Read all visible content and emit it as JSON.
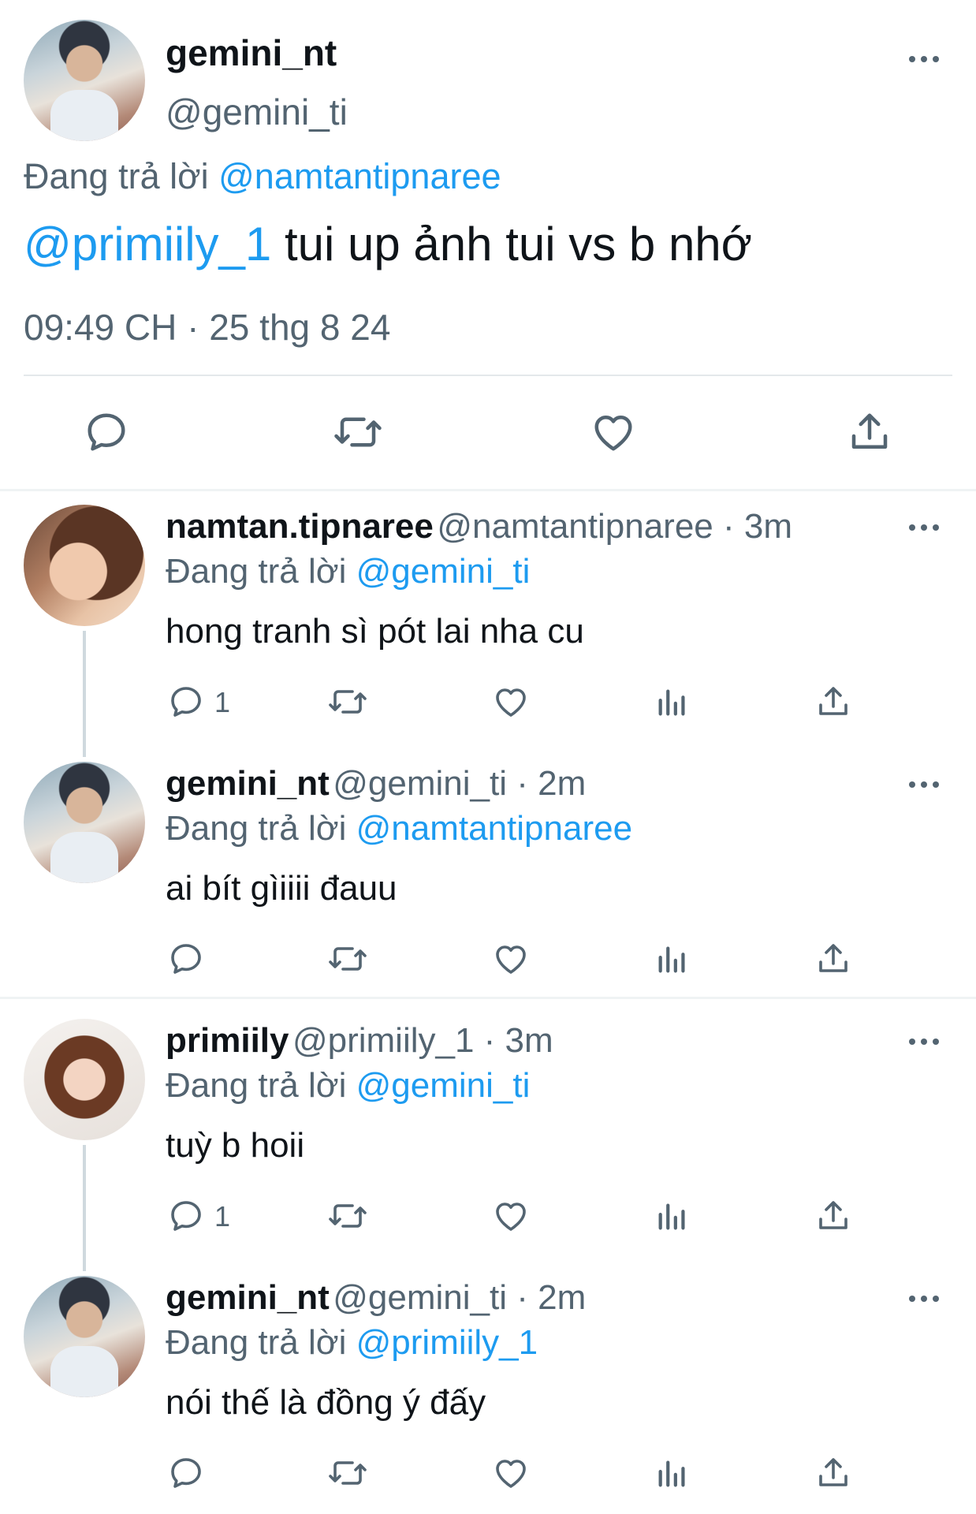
{
  "main_tweet": {
    "display_name": "gemini_nt",
    "handle": "@gemini_ti",
    "reply_prefix": "Đang trả lời",
    "reply_to": "@namtantipnaree",
    "mention": "@primiily_1",
    "body": "tui up ảnh tui vs b nhớ",
    "timestamp": "09:49 CH · 25 thg 8 24"
  },
  "replies": [
    {
      "display_name": "namtan.tipnaree",
      "handle_time": "@namtantipnaree · 3m",
      "reply_prefix": "Đang trả lời",
      "reply_to": "@gemini_ti",
      "body": "hong tranh sì pót lai nha cu",
      "reply_count": "1"
    },
    {
      "display_name": "gemini_nt",
      "handle_time": "@gemini_ti · 2m",
      "reply_prefix": "Đang trả lời",
      "reply_to": "@namtantipnaree",
      "body": "ai bít gìiiii đauu",
      "reply_count": ""
    },
    {
      "display_name": "primiily",
      "handle_time": "@primiily_1 · 3m",
      "reply_prefix": "Đang trả lời",
      "reply_to": "@gemini_ti",
      "body": "tuỳ b hoii",
      "reply_count": "1"
    },
    {
      "display_name": "gemini_nt",
      "handle_time": "@gemini_ti · 2m",
      "reply_prefix": "Đang trả lời",
      "reply_to": "@primiily_1",
      "body": "nói thế là đồng ý đấy",
      "reply_count": ""
    }
  ],
  "icons": {
    "reply": "reply-icon",
    "retweet": "retweet-icon",
    "like": "heart-icon",
    "views": "views-icon",
    "share": "share-icon",
    "more": "more-icon"
  },
  "colors": {
    "link": "#1d9bf0",
    "muted": "#536471",
    "text": "#0f1419"
  }
}
